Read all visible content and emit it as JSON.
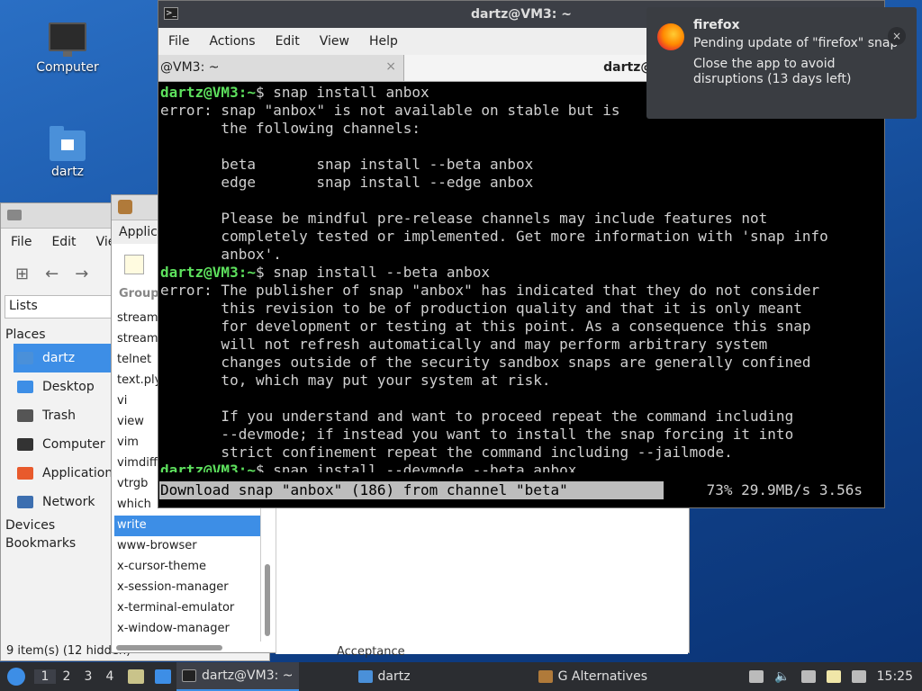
{
  "desktop": {
    "icons": [
      {
        "label": "Computer"
      },
      {
        "label": "dartz"
      }
    ]
  },
  "file_manager": {
    "menu": [
      "File",
      "Edit",
      "Vie"
    ],
    "path": "Lists",
    "places_heading": "Places",
    "places": [
      {
        "label": "dartz",
        "selected": true,
        "icon": "home-folder-icon",
        "color": "#4a90d9"
      },
      {
        "label": "Desktop",
        "icon": "desktop-icon",
        "color": "#3d8ee6"
      },
      {
        "label": "Trash",
        "icon": "trash-icon",
        "color": "#555555"
      },
      {
        "label": "Computer",
        "icon": "computer-icon",
        "color": "#333333"
      },
      {
        "label": "Application",
        "icon": "applications-icon",
        "color": "#e85a2c"
      },
      {
        "label": "Network",
        "icon": "network-icon",
        "color": "#3d6fb0"
      }
    ],
    "devices_heading": "Devices",
    "bookmarks_heading": "Bookmarks",
    "status": "9 item(s) (12 hidden)"
  },
  "alternatives": {
    "applic_label": "Applic",
    "group_heading": "Group",
    "items": [
      "stream",
      "stream",
      "telnet",
      "text.ply",
      "vi",
      "view",
      "vim",
      "vimdiff",
      "vtrgb",
      "which",
      "write",
      "www-browser",
      "x-cursor-theme",
      "x-session-manager",
      "x-terminal-emulator",
      "x-window-manager"
    ],
    "selected_item": "write",
    "bottom_text": "Acceptance"
  },
  "terminal": {
    "title": "dartz@VM3: ~",
    "menu": [
      "File",
      "Actions",
      "Edit",
      "View",
      "Help"
    ],
    "tabs": [
      {
        "label": "@VM3: ~",
        "active": false
      },
      {
        "label": "dartz@VM3",
        "active": true
      }
    ],
    "prompt": "dartz@VM3:~",
    "lines": [
      {
        "prompt": "dartz@VM3:~",
        "text": "$ snap install anbox"
      },
      {
        "text": "error: snap \"anbox\" is not available on stable but is"
      },
      {
        "text": "       the following channels:"
      },
      {
        "text": ""
      },
      {
        "text": "       beta       snap install --beta anbox"
      },
      {
        "text": "       edge       snap install --edge anbox"
      },
      {
        "text": ""
      },
      {
        "text": "       Please be mindful pre-release channels may include features not"
      },
      {
        "text": "       completely tested or implemented. Get more information with 'snap info"
      },
      {
        "text": "       anbox'."
      },
      {
        "prompt": "dartz@VM3:~",
        "text": "$ snap install --beta anbox"
      },
      {
        "text": "error: The publisher of snap \"anbox\" has indicated that they do not consider"
      },
      {
        "text": "       this revision to be of production quality and that it is only meant"
      },
      {
        "text": "       for development or testing at this point. As a consequence this snap"
      },
      {
        "text": "       will not refresh automatically and may perform arbitrary system"
      },
      {
        "text": "       changes outside of the security sandbox snaps are generally confined"
      },
      {
        "text": "       to, which may put your system at risk."
      },
      {
        "text": ""
      },
      {
        "text": "       If you understand and want to proceed repeat the command including"
      },
      {
        "text": "       --devmode; if instead you want to install the snap forcing it into"
      },
      {
        "text": "       strict confinement repeat the command including --jailmode."
      },
      {
        "prompt": "dartz@VM3:~",
        "text": "$ snap install --devmode --beta anbox"
      }
    ],
    "progress_text": "Download snap \"anbox\" (186) from channel \"beta\"",
    "progress_stats": "73% 29.9MB/s 3.56s",
    "progress_percent": 73
  },
  "notification": {
    "app": "firefox",
    "line1": "Pending update of \"firefox\" snap",
    "line2": "Close the app to avoid disruptions (13 days left)",
    "close_label": "×"
  },
  "taskbar": {
    "workspaces": [
      "1",
      "2",
      "3",
      "4"
    ],
    "tasks": [
      {
        "label": "dartz@VM3: ~",
        "active": true,
        "icon": "terminal-icon"
      },
      {
        "label": "dartz",
        "active": false,
        "icon": "folder-icon"
      },
      {
        "label": "G Alternatives",
        "active": false,
        "icon": "alternatives-icon"
      }
    ],
    "clock": "15:25"
  }
}
